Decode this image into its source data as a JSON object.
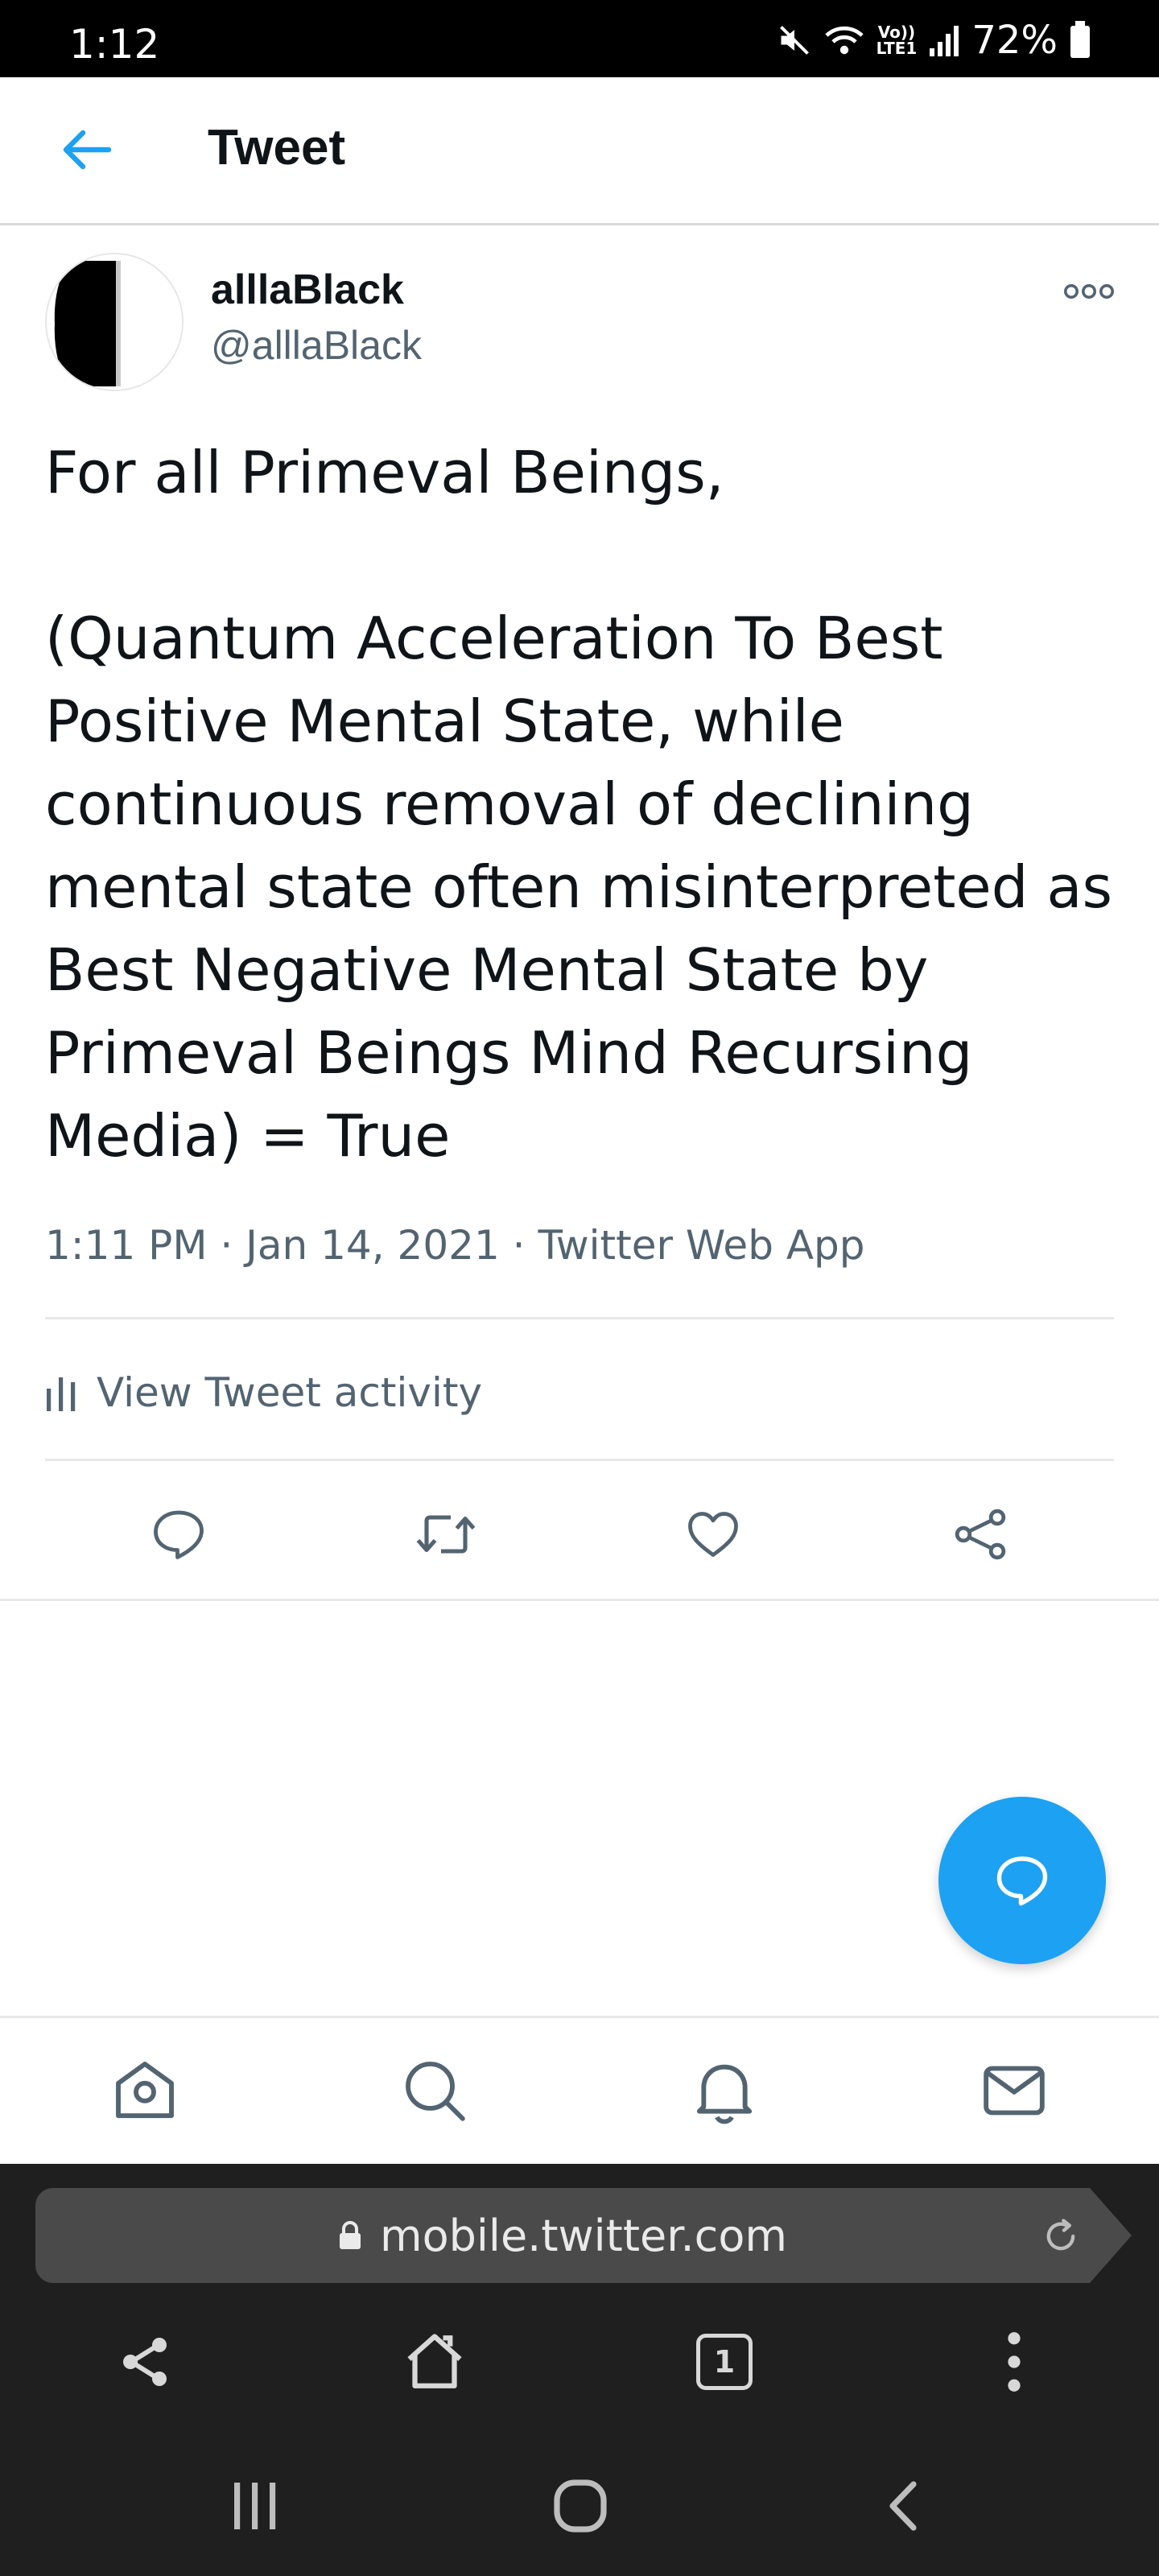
{
  "status_bar": {
    "time": "1:12",
    "battery_percent": "72%",
    "network_label_top": "Vo))",
    "network_label_bottom": "LTE1"
  },
  "header": {
    "title": "Tweet",
    "back_icon": "arrow-left-icon"
  },
  "tweet": {
    "author_name": "alllaBlack",
    "author_handle": "@alllaBlack",
    "text": "For all Primeval Beings,\n\n(Quantum Acceleration To Best Positive Mental State, while continuous removal of declining mental state often misinterpreted as Best Negative Mental State by Primeval Beings Mind Recursing Media) = True",
    "meta": "1:11 PM · Jan 14, 2021 · Twitter Web App",
    "activity_label": "View Tweet activity",
    "actions": [
      "reply-icon",
      "retweet-icon",
      "like-icon",
      "share-icon"
    ]
  },
  "bottom_nav": {
    "items": [
      "home-icon",
      "search-icon",
      "notifications-icon",
      "messages-icon"
    ]
  },
  "browser": {
    "url": "mobile.twitter.com",
    "tab_count": "1"
  },
  "colors": {
    "accent": "#1da1f2",
    "text_primary": "#0f1419",
    "text_secondary": "#536471",
    "divider": "#e8e8e8",
    "browser_bg": "#1f1f1f"
  }
}
